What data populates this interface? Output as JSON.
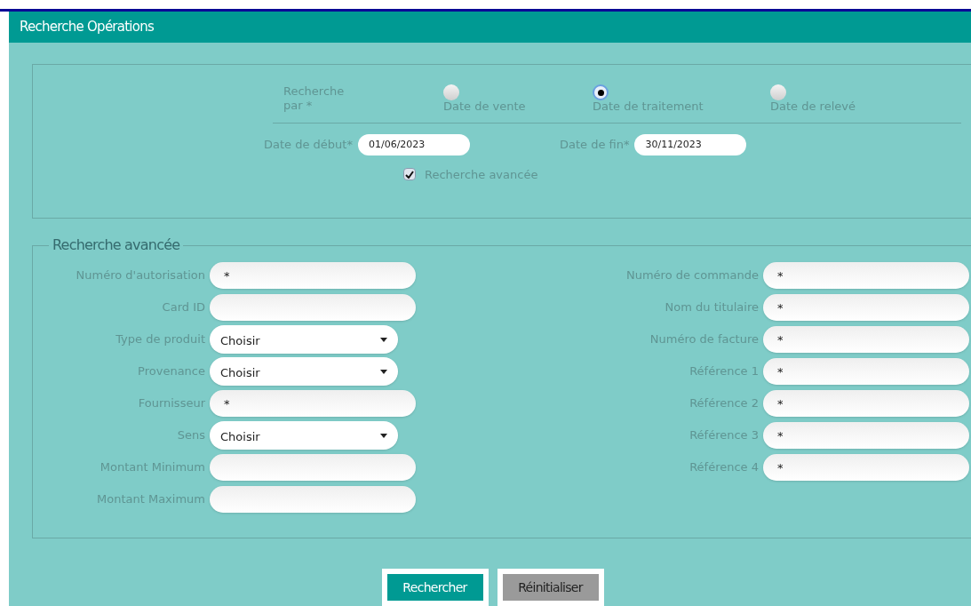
{
  "panel": {
    "title": "Recherche Opérations"
  },
  "search_by": {
    "label": "Recherche par *",
    "options": [
      {
        "label": "Date de vente",
        "selected": false
      },
      {
        "label": "Date de traitement",
        "selected": true
      },
      {
        "label": "Date de relevé",
        "selected": false
      }
    ]
  },
  "dates": [
    {
      "label": "Date de début*",
      "value": "01/06/2023"
    },
    {
      "label": "Date de fin*",
      "value": "30/11/2023"
    }
  ],
  "advanced_toggle": {
    "label": "Recherche avancée",
    "checked": true
  },
  "advanced": {
    "legend": "Recherche avancée",
    "left_fields": [
      {
        "kind": "text",
        "label": "Numéro d'autorisation",
        "value": "*"
      },
      {
        "kind": "text",
        "label": "Card ID"
      },
      {
        "kind": "select",
        "label": "Type de produit",
        "value": "Choisir"
      },
      {
        "kind": "select",
        "label": "Provenance",
        "value": "Choisir"
      },
      {
        "kind": "text",
        "label": "Fournisseur",
        "value": "*"
      },
      {
        "kind": "select",
        "label": "Sens",
        "value": "Choisir"
      },
      {
        "kind": "text",
        "label": "Montant Minimum"
      },
      {
        "kind": "text",
        "label": "Montant Maximum"
      }
    ],
    "right_fields": [
      {
        "kind": "text",
        "label": "Numéro de commande",
        "value": "*"
      },
      {
        "kind": "text",
        "label": "Nom du titulaire",
        "value": "*"
      },
      {
        "kind": "text",
        "label": "Numéro de facture",
        "value": "*"
      },
      {
        "kind": "text",
        "label": "Référence 1",
        "value": "*"
      },
      {
        "kind": "text",
        "label": "Référence 2",
        "value": "*"
      },
      {
        "kind": "text",
        "label": "Référence 3",
        "value": "*"
      },
      {
        "kind": "text",
        "label": "Référence 4",
        "value": "*"
      }
    ]
  },
  "buttons": [
    {
      "kind": "primary",
      "label": "Rechercher"
    },
    {
      "kind": "secondary",
      "label": "Réinitialiser"
    }
  ]
}
